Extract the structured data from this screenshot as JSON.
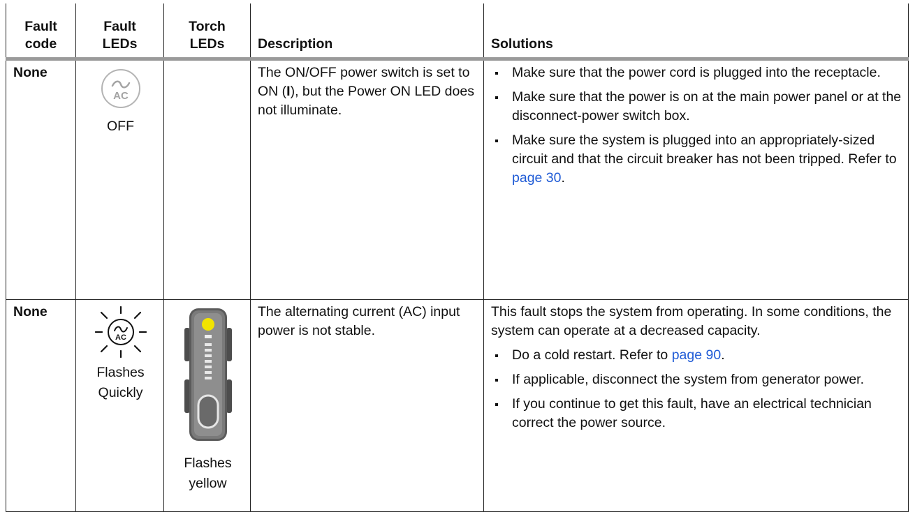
{
  "columns": {
    "fault_code": [
      "Fault",
      "code"
    ],
    "fault_leds": [
      "Fault",
      "LEDs"
    ],
    "torch_leds": [
      "Torch",
      "LEDs"
    ],
    "description": "Description",
    "solutions": "Solutions"
  },
  "rows": [
    {
      "code": "None",
      "fault_led": {
        "icon": "ac-power-led-off",
        "label": "AC",
        "state": "OFF"
      },
      "torch_led": null,
      "description": {
        "before": "The ON/OFF power switch is set to ON (",
        "bold": "I",
        "after": "), but the Power ON LED does not illuminate."
      },
      "solutions": {
        "intro": "",
        "items": [
          {
            "text": "Make sure that the power cord is plugged into the receptacle."
          },
          {
            "text": "Make sure that the power is on at the main power panel or at the disconnect-power switch box."
          },
          {
            "text": "Make sure the system is plugged into an appropriately-sized circuit and that the circuit breaker has not been tripped. Refer to ",
            "link": "page 30",
            "after": "."
          }
        ]
      }
    },
    {
      "code": "None",
      "fault_led": {
        "icon": "ac-power-led-flashing",
        "label": "AC",
        "state": [
          "Flashes",
          "Quickly"
        ]
      },
      "torch_led": {
        "icon": "torch-led-panel-icon",
        "state": [
          "Flashes",
          "yellow"
        ],
        "color": "#f2e400"
      },
      "description": "The alternating current (AC) input power is not stable.",
      "solutions": {
        "intro": "This fault stops the system from operating. In some conditions, the system can operate at a decreased capacity.",
        "items": [
          {
            "text": "Do a cold restart. Refer to ",
            "link": "page 90",
            "after": "."
          },
          {
            "text": "If applicable, disconnect the system from generator power."
          },
          {
            "text": "If you continue to get this fault, have an electrical technician correct the power source."
          }
        ]
      }
    }
  ],
  "colors": {
    "link": "#1f5bd6",
    "header_rule": "#9a9a9a",
    "led_yellow": "#f2e400"
  }
}
